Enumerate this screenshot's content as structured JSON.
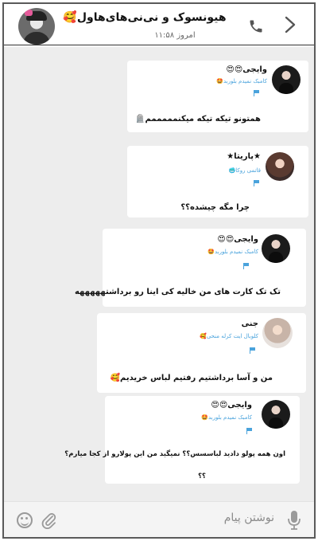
{
  "header": {
    "title": "هیونسوک و نی‌نی‌های‌هاول🥰",
    "subtitle": "امروز ۱۱:۵۸"
  },
  "messages": [
    {
      "name": "وایجی😍😍",
      "role": "کامبک نمیدم بلوربد🤩",
      "text": "همتونو تیکه تیکه میکنمممممم🪦"
    },
    {
      "name": "★پاریتا★",
      "role": "قاتمی روکا🥶",
      "text": "چرا مگه چیشده؟؟"
    },
    {
      "name": "وایجی😍😍",
      "role": "کامبک نمیدم بلوربد🤩",
      "text": "تک تک کارت های من خالیه کی اینا رو برداشتهههههه"
    },
    {
      "name": "جنی",
      "role": "کلوبال ایت کرله منحی🥰",
      "text": "من و آسا برداشتیم رفتیم لباس خریدیم🥰"
    },
    {
      "name": "وایجی😍😍",
      "role": "کامبک نمیدم بلوربد🤩",
      "text": "اون همه پولو دادید لباسسس؟؟ نمیگید من این پولارو از کجا میارم؟",
      "text2": "؟؟"
    }
  ],
  "input": {
    "placeholder": "نوشتن پیام"
  },
  "icons": {
    "back": "chevron-right-icon",
    "call": "phone-icon",
    "mic": "microphone-icon",
    "attach": "paperclip-icon",
    "emoji": "smiley-icon"
  },
  "colors": {
    "accent": "#4aa3dc",
    "chat_bg": "#ededed"
  }
}
